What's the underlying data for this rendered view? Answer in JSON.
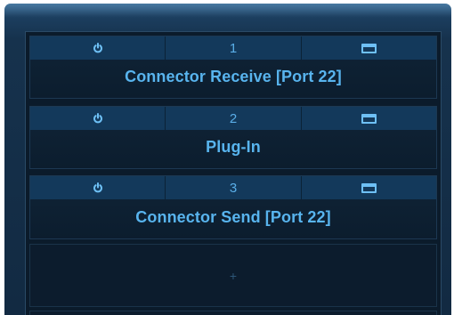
{
  "slots": [
    {
      "number": "1",
      "title": "Connector Receive [Port 22]"
    },
    {
      "number": "2",
      "title": "Plug-In"
    },
    {
      "number": "3",
      "title": "Connector Send [Port 22]"
    }
  ],
  "add_slot": {
    "label": "+"
  },
  "icons": {
    "power": "power-icon",
    "window": "window-icon"
  },
  "colors": {
    "accent_text": "#58b4ee",
    "header_bg": "#13395b",
    "frame": "#1c3f60"
  }
}
